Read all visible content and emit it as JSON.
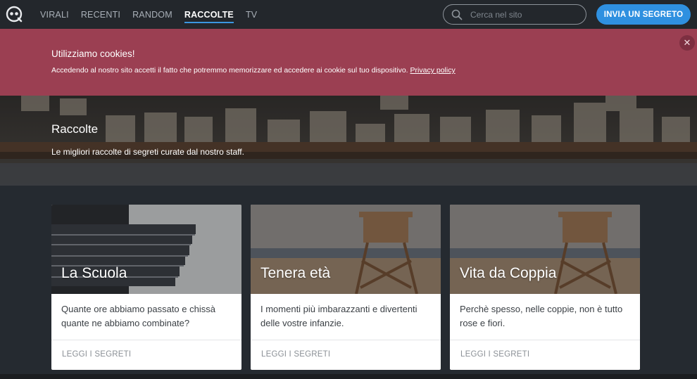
{
  "nav": {
    "items": [
      {
        "label": "VIRALI",
        "active": false
      },
      {
        "label": "RECENTI",
        "active": false
      },
      {
        "label": "RANDOM",
        "active": false
      },
      {
        "label": "RACCOLTE",
        "active": true
      },
      {
        "label": "TV",
        "active": false
      }
    ],
    "search_placeholder": "Cerca nel sito",
    "cta_label": "INVIA UN SEGRETO"
  },
  "cookie": {
    "title": "Utilizziamo cookies!",
    "text": "Accedendo al nostro sito accetti il fatto che potremmo memorizzare ed accedere ai cookie sul tuo dispositivo.",
    "link": "Privacy policy",
    "close": "✕"
  },
  "hero": {
    "title": "Raccolte",
    "subtitle": "Le migliori raccolte di segreti curate dal nostro staff."
  },
  "cards": [
    {
      "title": "La Scuola",
      "description": "Quante ore abbiamo passato e chissà quante ne abbiamo combinate?",
      "link": "LEGGI I SEGRETI"
    },
    {
      "title": "Tenera età",
      "description": "I momenti più imbarazzanti e divertenti delle vostre infanzie.",
      "link": "LEGGI I SEGRETI"
    },
    {
      "title": "Vita da Coppia",
      "description": "Perchè spesso, nelle coppie, non è tutto rose e fiori.",
      "link": "LEGGI I SEGRETI"
    }
  ],
  "colors": {
    "topbar": "#23272c",
    "accent": "#2f90e0",
    "cookie_bg": "#9b3f52",
    "page_bg": "#252a30"
  }
}
